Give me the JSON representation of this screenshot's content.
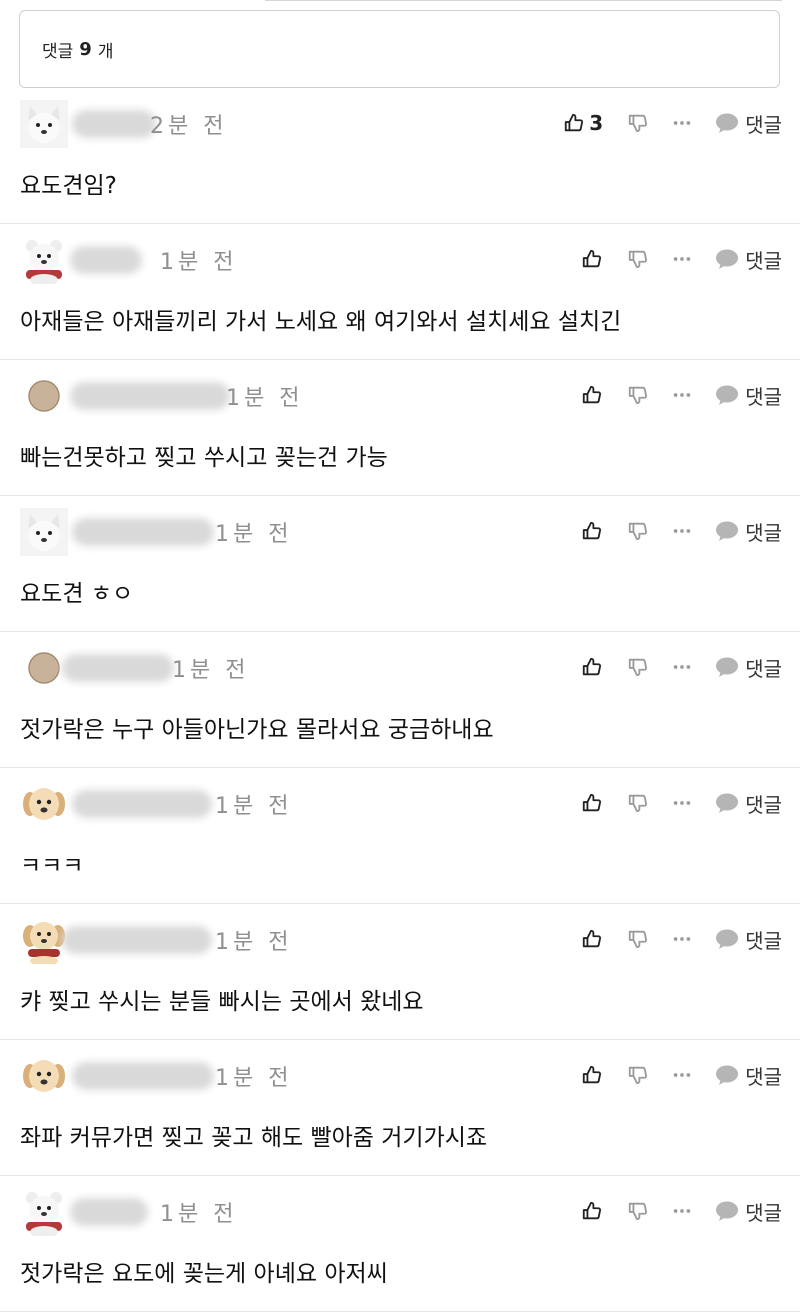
{
  "header": {
    "prefix": "댓글",
    "count": "9",
    "suffix": "개"
  },
  "reply_label": "댓글",
  "comments": [
    {
      "avatar": "white-dog",
      "time": "2분 전",
      "likes": "3",
      "text": "요도견임?"
    },
    {
      "avatar": "white-bear",
      "time": "1분 전",
      "likes": "",
      "text": "아재들은 아재들끼리 가서 노세요 왜 여기와서 설치세요 설치긴"
    },
    {
      "avatar": "tan-circle",
      "time": "1분 전",
      "likes": "",
      "text": "빠는건못하고 찢고 쑤시고 꽂는건 가능"
    },
    {
      "avatar": "white-dog",
      "time": "1분 전",
      "likes": "",
      "text": "요도견 ㅎㅇ"
    },
    {
      "avatar": "tan-circle",
      "time": "1분 전",
      "likes": "",
      "text": "젓가락은 누구 아들아닌가요 몰라서요 궁금하내요"
    },
    {
      "avatar": "puppy",
      "time": "1분 전",
      "likes": "",
      "text": "ㅋㅋㅋ"
    },
    {
      "avatar": "puppy-red",
      "time": "1분 전",
      "likes": "",
      "text": "캬 찢고 쑤시는 분들 빠시는 곳에서 왔네요"
    },
    {
      "avatar": "puppy",
      "time": "1분 전",
      "likes": "",
      "text": "좌파 커뮤가면 찢고 꽂고 해도 빨아줌 거기가시죠"
    },
    {
      "avatar": "white-bear",
      "time": "1분 전",
      "likes": "",
      "text": "젓가락은 요도에 꽂는게 아녜요 아저씨"
    }
  ],
  "colors": {
    "icon": "#9a9a9a",
    "like_icon": "#222222",
    "divider": "#e6e6e6"
  }
}
